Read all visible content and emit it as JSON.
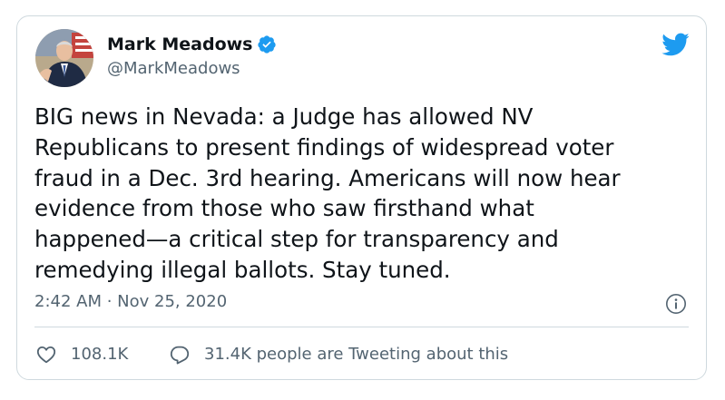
{
  "colors": {
    "brand_blue": "#1d9bf0",
    "text_primary": "#0f1419",
    "text_secondary": "#536471",
    "border": "#cfd9de"
  },
  "author": {
    "display_name": "Mark Meadows",
    "handle": "@MarkMeadows",
    "verified": true,
    "avatar_icon": "profile-photo"
  },
  "tweet": {
    "text": "BIG news in Nevada: a Judge has allowed NV\nRepublicans to present findings of widespread voter\nfraud in a Dec. 3rd hearing. Americans will now hear\nevidence from those who saw firsthand what\nhappened—a critical step for transparency and\nremedying illegal ballots. Stay tuned.",
    "timestamp": "2:42 AM · Nov 25, 2020"
  },
  "actions": {
    "likes": "108.1K",
    "replies_label": "31.4K people are Tweeting about this"
  },
  "icons": {
    "logo": "twitter-bird-icon",
    "verified": "verified-badge-icon",
    "info": "info-icon",
    "like": "heart-icon",
    "reply": "speech-bubble-icon"
  }
}
